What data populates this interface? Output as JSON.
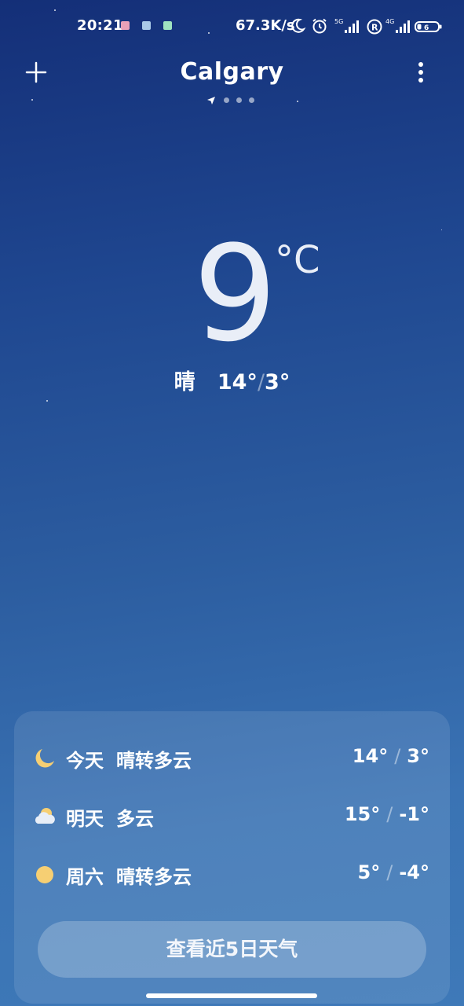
{
  "status_bar": {
    "time": "20:21",
    "net_speed": "67.3K/s",
    "icons": [
      "moon-icon",
      "alarm-icon",
      "signal-5g-icon",
      "roaming-r-icon",
      "signal-4g-icon",
      "battery-icon"
    ],
    "signal_5g_label": "5G",
    "signal_4g_label": "4G",
    "roaming_label": "R",
    "battery_level": "6"
  },
  "header": {
    "city": "Calgary",
    "add_icon": "plus-icon",
    "more_icon": "more-vertical-icon",
    "pages_count": 4,
    "current_page": 1
  },
  "current": {
    "temperature": "9",
    "unit": "°C",
    "condition": "晴",
    "high": "14°",
    "low": "3°"
  },
  "forecast": [
    {
      "day": "今天",
      "condition": "晴转多云",
      "high": "14°",
      "low": "3°",
      "icon": "crescent-moon-icon"
    },
    {
      "day": "明天",
      "condition": "多云",
      "high": "15°",
      "low": "-1°",
      "icon": "cloudy-icon"
    },
    {
      "day": "周六",
      "condition": "晴转多云",
      "high": "5°",
      "low": "-4°",
      "icon": "sun-icon"
    }
  ],
  "five_day_button_label": "查看近5日天气",
  "colors": {
    "bg_top": "#142f78",
    "bg_bottom": "#3e79b8",
    "sun": "#f6cf73",
    "moon": "#f6cf73"
  }
}
